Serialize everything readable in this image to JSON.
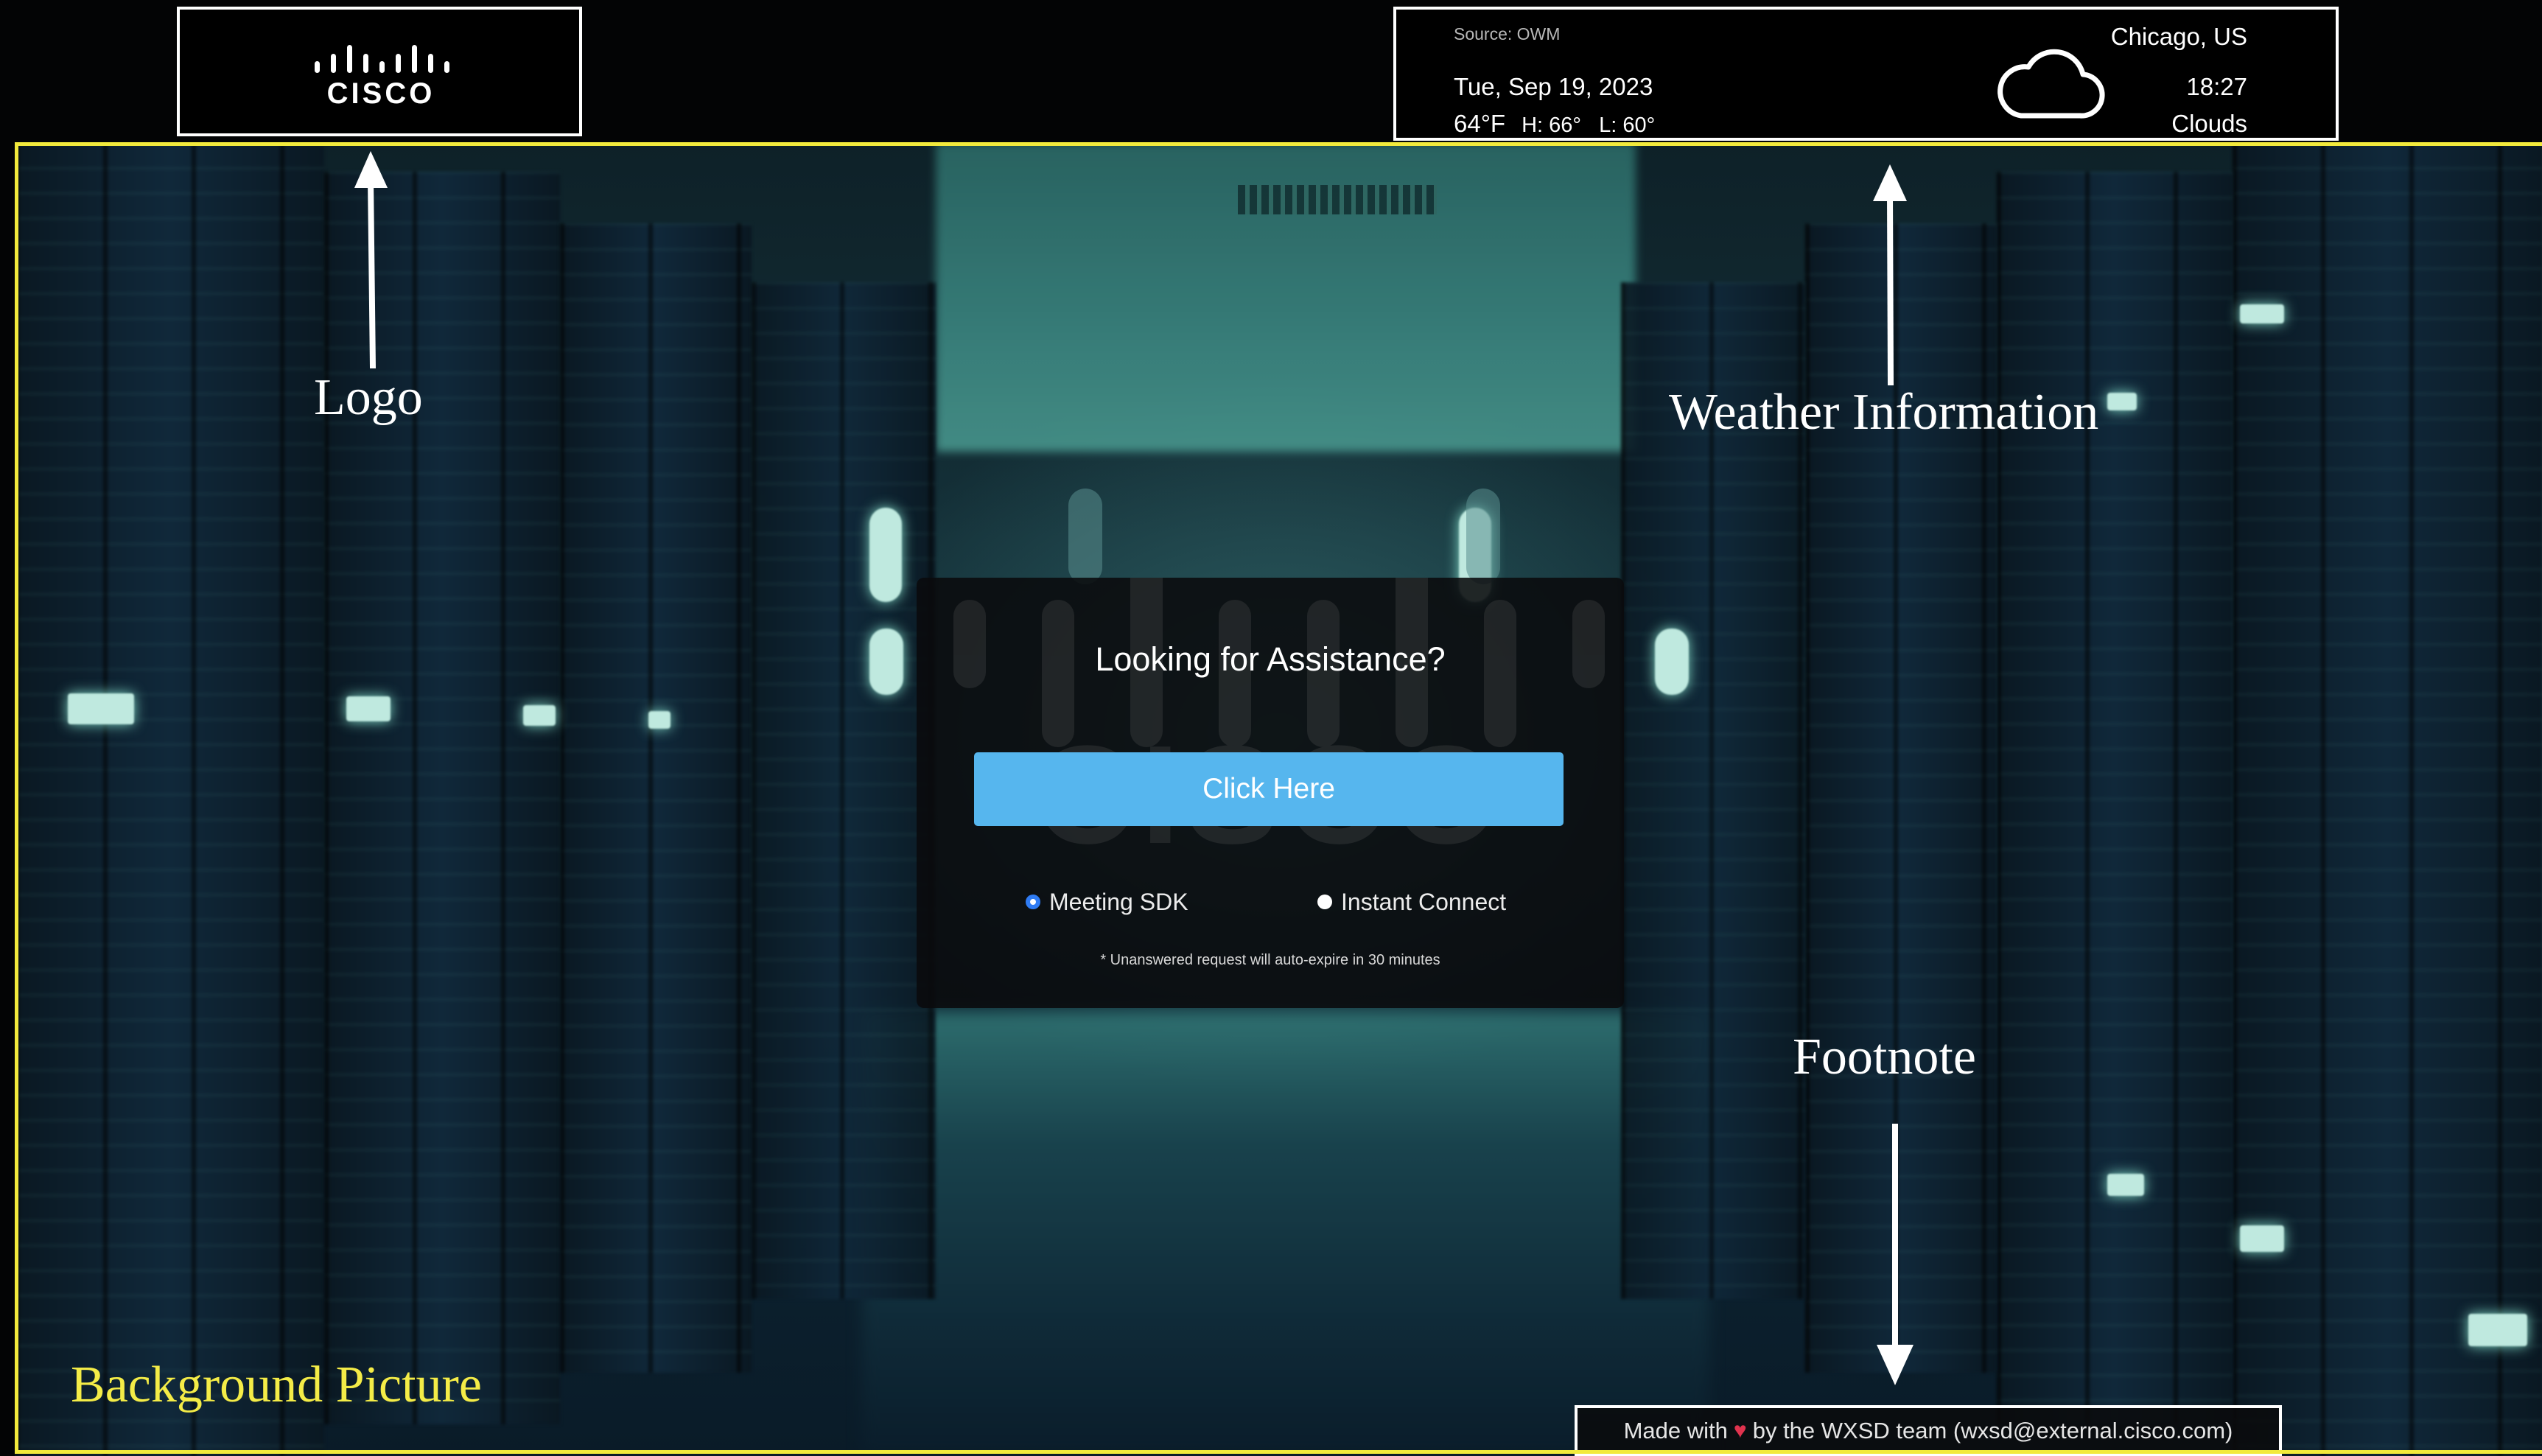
{
  "logo": {
    "brand": "CISCO",
    "icon": "cisco-bars-icon"
  },
  "weather": {
    "source": "Source: OWM",
    "date": "Tue, Sep 19, 2023",
    "temperature": "64°F",
    "high_low": "H: 66°   L: 60°",
    "location": "Chicago, US",
    "time": "18:27",
    "condition": "Clouds",
    "icon": "cloud-icon"
  },
  "dialog": {
    "title": "Looking for Assistance?",
    "button_label": "Click Here",
    "options": [
      {
        "label": "Meeting SDK",
        "checked": true
      },
      {
        "label": "Instant Connect",
        "checked": false
      }
    ],
    "note": "* Unanswered request will auto-expire in 30 minutes"
  },
  "footnote": {
    "prefix": "Made with",
    "suffix": "by the WXSD team (wxsd@external.cisco.com)",
    "icon": "heart-icon"
  },
  "annotations": {
    "logo": "Logo",
    "weather": "Weather Information",
    "footnote": "Footnote",
    "background": "Background Picture"
  },
  "colors": {
    "button": "#56b6ee",
    "annotation_frame": "#f2ea3c",
    "radio_selected": "#2f7bf3",
    "heart": "#e0334e"
  }
}
